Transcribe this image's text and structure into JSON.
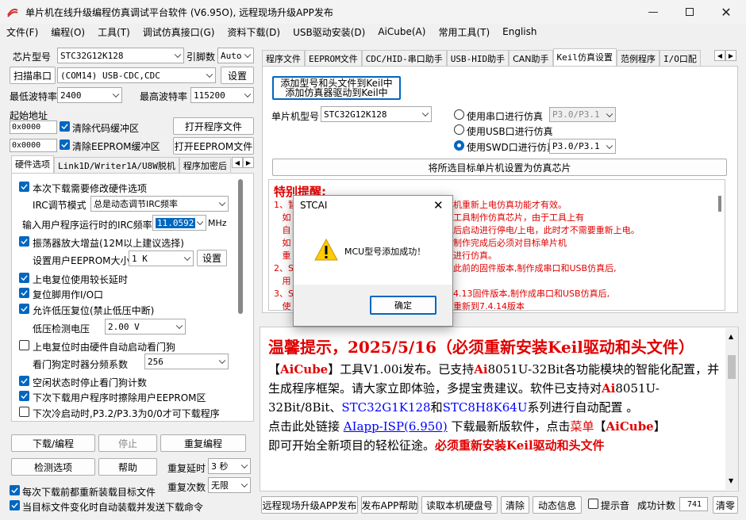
{
  "window": {
    "title": "单片机在线升级编程仿真调试平台软件 (V6.95O), 远程现场升级APP发布"
  },
  "menu": [
    "文件(F)",
    "编程(O)",
    "工具(T)",
    "调试仿真接口(G)",
    "资料下载(D)",
    "USB驱动安装(D)",
    "AiCube(A)",
    "常用工具(T)",
    "English"
  ],
  "left": {
    "chip_label": "芯片型号",
    "chip_value": "STC32G12K128",
    "pins_label": "引脚数",
    "pins_value": "Auto",
    "scan_label": "扫描串口",
    "port_value": "(COM14) USB-CDC,CDC",
    "settings_label": "设置",
    "min_baud_label": "最低波特率",
    "min_baud_value": "2400",
    "max_baud_label": "最高波特率",
    "max_baud_value": "115200",
    "start_addr_label": "起始地址",
    "addr1": "0x0000",
    "clear_code": "清除代码缓冲区",
    "open_prog": "打开程序文件",
    "addr2": "0x0000",
    "clear_eeprom": "清除EEPROM缓冲区",
    "open_eeprom": "打开EEPROM文件",
    "tabs": [
      "硬件选项",
      "Link1D/Writer1A/U8W脱机",
      "程序加密后"
    ],
    "hw": {
      "opt1": "本次下载需要修改硬件选项",
      "irc_mode_label": "IRC调节模式",
      "irc_mode_value": "总是动态调节IRC频率",
      "irc_freq_label": "输入用户程序运行时的IRC频率",
      "irc_freq_value": "11.0592",
      "mhz": "MHz",
      "opt2": "振荡器放大增益(12M以上建议选择)",
      "eeprom_size_label": "设置用户EEPROM大小",
      "eeprom_size_value": "1  K",
      "settings": "设置",
      "opt3": "上电复位使用较长延时",
      "opt4": "复位脚用作I/O口",
      "opt5": "允许低压复位(禁止低压中断)",
      "lvd_label": "低压检测电压",
      "lvd_value": "2.00 V",
      "opt6": "上电复位时由硬件自动启动看门狗",
      "wdt_label": "看门狗定时器分频系数",
      "wdt_value": "256",
      "opt7": "空闲状态时停止看门狗计数",
      "opt8": "下次下载用户程序时擦除用户EEPROM区",
      "opt9": "下次冷启动时,P3.2/P3.3为0/0才可下载程序"
    },
    "download": "下载/编程",
    "stop": "停止",
    "reprogram": "重复编程",
    "detect": "检测选项",
    "help": "帮助",
    "repeat_delay_label": "重复延时",
    "repeat_delay_value": "3 秒",
    "repeat_count_label": "重复次数",
    "repeat_count_value": "无限",
    "reload_cb": "每次下载前都重新装载目标文件",
    "auto_cb": "当目标文件变化时自动装载并发送下载命令"
  },
  "right": {
    "tabs": [
      "程序文件",
      "EEPROM文件",
      "CDC/HID-串口助手",
      "USB-HID助手",
      "CAN助手",
      "Keil仿真设置",
      "范例程序",
      "I/O口配"
    ],
    "add_keil_btn": [
      "添加型号和头文件到Keil中",
      "添加仿真器驱动到Keil中"
    ],
    "mcu_label": "单片机型号",
    "mcu_value": "STC32G12K128",
    "radio1": "使用串口进行仿真",
    "radio1_value": "P3.0/P3.1",
    "radio2": "使用USB口进行仿真",
    "radio3": "使用SWD口进行仿真",
    "radio3_value": "P3.0/P3.1",
    "set_chip_btn": "将所选目标单片机设置为仿真芯片",
    "warn_title": "特别提醒:",
    "warn_lines": [
      "1、暂",
      "   如",
      "   自",
      "   如",
      "   重",
      "2、ST",
      "   用",
      "3、ST",
      "   使"
    ],
    "warn_right": [
      "机重新上电仿真功能才有效。",
      "工具制作仿真芯片，由于工具上有",
      "后启动进行停电/上电，此时才不需要重新上电。",
      "制作完成后必须对目标单片机",
      "进行仿真。",
      "此前的固件版本,制作成串口和USB仿真后,",
      "",
      "4.13固件版本,制作成串口和USB仿真后,",
      "重新到7.4.14版本"
    ],
    "notice_title": "温馨提示，2025/5/16（必须重新安装Keil驱动和头文件）",
    "notice": {
      "p1": "【",
      "aicube": "AiCube",
      "p2": "】工具V1.00i发布。已支持",
      "ai": "Ai",
      "p3": "8051U-32Bit各功能模块的智能化配置，并生成程序框架。请大家立即体验，多提宝贵建议。软件已支持对",
      "ai2": "Ai",
      "p4": "8051U-32Bit/8Bit、",
      "stc1": "STC32G1K128",
      "p5": "和",
      "stc2": "STC8H8K64U",
      "p6": "系列进行自动配置 。",
      "p7": "点击此处链接 ",
      "link": "AIapp-ISP(6.950)",
      "p8": " 下载最新版软件，点击",
      "menu": "菜单",
      "p9": "【",
      "aicube2": "AiCube",
      "p10": "】",
      "p11": "即可开始全新项目的轻松征途。",
      "must": "必须重新安装Keil驱动和头文件"
    },
    "bottom": [
      "远程现场升级APP发布",
      "发布APP帮助",
      "读取本机硬盘号",
      "清除",
      "动态信息"
    ],
    "beep": "提示音",
    "count_label": "成功计数",
    "count_value": "741",
    "clear": "清零"
  },
  "dialog": {
    "title": "STCAI",
    "message": "MCU型号添加成功！",
    "ok": "确定"
  },
  "colors": {
    "accent": "#0067c0",
    "red": "#e00000",
    "blue": "#0000ff"
  }
}
